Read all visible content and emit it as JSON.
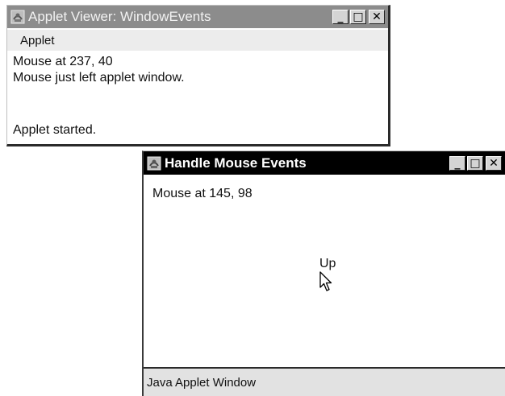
{
  "window1": {
    "title": "Applet Viewer: WindowEvents",
    "menu": [
      "Applet"
    ],
    "lines": [
      "Mouse at 237, 40",
      "Mouse just left applet window."
    ],
    "status": "Applet started.",
    "controls": {
      "minimize": "_",
      "maximize": "□",
      "close": "✕"
    }
  },
  "window2": {
    "title": "Handle Mouse Events",
    "mouse_text": "Mouse at 145, 98",
    "up_text": "Up",
    "status": "Java Applet Window",
    "controls": {
      "minimize": "_",
      "maximize": "□",
      "close": "✕"
    }
  },
  "colors": {
    "inactive_titlebar": "#8c8c8c",
    "active_titlebar": "#000000",
    "menubar": "#ececec",
    "statusbar": "#e2e2e2"
  },
  "icons": {
    "system_icon": "java-applet-icon",
    "pointer": "arrow-pointer-icon"
  }
}
